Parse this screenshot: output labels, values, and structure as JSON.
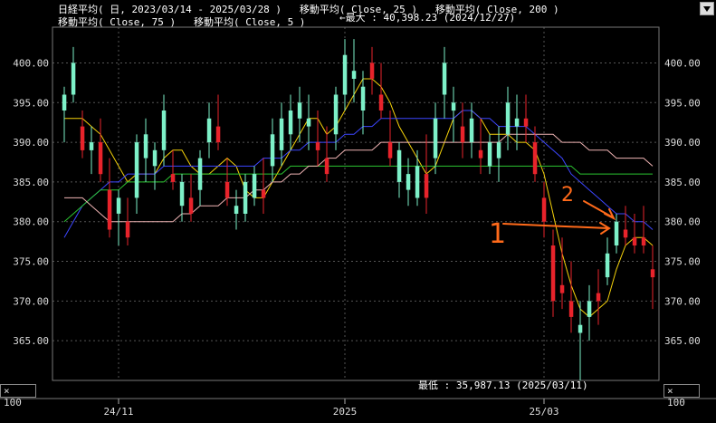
{
  "legend": {
    "line1": "日経平均( 日, 2023/03/14 - 2025/03/28 )   移動平均( Close, 25 )   移動平均( Close, 200 )",
    "line2": "移動平均( Close, 75 )   移動平均( Close, 5 )"
  },
  "annotations": {
    "max": "←最大 : 40,398.23 (2024/12/27)",
    "min": "最低 : 35,987.13 (2025/03/11)",
    "mark1": "1",
    "mark2": "2"
  },
  "scale_label": "× 100",
  "colors": {
    "up": "#7df0c8",
    "down": "#e8232b",
    "ma5": "#f5d20a",
    "ma25": "#3c46ff",
    "ma75": "#2bc431",
    "ma200": "#f0b4b4",
    "grid": "#555555",
    "annotation": "#ff6a1a"
  },
  "chart_data": {
    "type": "candlestick",
    "y_unit": "× 100 yen",
    "ylim": [
      360,
      404
    ],
    "y_ticks": [
      "365.00",
      "370.00",
      "375.00",
      "380.00",
      "385.00",
      "390.00",
      "395.00",
      "400.00"
    ],
    "x_labels": [
      "24/11",
      "2025",
      "25/03"
    ],
    "x_label_index": [
      6,
      31,
      53
    ],
    "grid": true,
    "max_label": "40,398.23 (2024/12/27)",
    "min_label": "35,987.13 (2025/03/11)",
    "ohlc": [
      [
        394,
        397,
        390,
        396
      ],
      [
        396,
        402,
        395,
        400
      ],
      [
        392,
        394,
        388,
        389
      ],
      [
        389,
        392,
        386,
        390
      ],
      [
        390,
        393,
        385,
        386
      ],
      [
        384,
        388,
        378,
        379
      ],
      [
        381,
        384,
        377,
        383
      ],
      [
        380,
        383,
        377,
        378
      ],
      [
        383,
        391,
        381,
        390
      ],
      [
        388,
        393,
        385,
        391
      ],
      [
        387,
        390,
        384,
        389
      ],
      [
        389,
        396,
        387,
        394
      ],
      [
        386,
        389,
        384,
        385
      ],
      [
        382,
        386,
        380,
        385
      ],
      [
        383,
        386,
        380,
        381
      ],
      [
        384,
        389,
        382,
        388
      ],
      [
        390,
        395,
        388,
        393
      ],
      [
        392,
        396,
        389,
        390
      ],
      [
        385,
        388,
        382,
        383
      ],
      [
        381,
        384,
        379,
        382
      ],
      [
        381,
        386,
        380,
        385
      ],
      [
        383,
        387,
        382,
        386
      ],
      [
        384,
        388,
        381,
        383
      ],
      [
        387,
        393,
        385,
        391
      ],
      [
        389,
        395,
        387,
        393
      ],
      [
        391,
        396,
        389,
        394
      ],
      [
        393,
        397,
        390,
        395
      ],
      [
        392,
        396,
        389,
        393
      ],
      [
        390,
        394,
        387,
        389
      ],
      [
        388,
        392,
        385,
        386
      ],
      [
        391,
        397,
        389,
        396
      ],
      [
        396,
        403,
        394,
        401
      ],
      [
        398,
        403,
        395,
        399
      ],
      [
        394,
        399,
        391,
        397
      ],
      [
        400,
        402,
        396,
        398
      ],
      [
        396,
        400,
        393,
        394
      ],
      [
        390,
        394,
        387,
        388
      ],
      [
        385,
        390,
        383,
        389
      ],
      [
        384,
        388,
        382,
        386
      ],
      [
        383,
        389,
        382,
        387
      ],
      [
        386,
        391,
        381,
        383
      ],
      [
        388,
        395,
        386,
        393
      ],
      [
        396,
        402,
        393,
        400
      ],
      [
        394,
        397,
        390,
        395
      ],
      [
        392,
        395,
        388,
        390
      ],
      [
        390,
        395,
        388,
        393
      ],
      [
        389,
        393,
        386,
        388
      ],
      [
        387,
        391,
        386,
        390
      ],
      [
        388,
        392,
        385,
        390
      ],
      [
        391,
        397,
        389,
        395
      ],
      [
        392,
        396,
        389,
        393
      ],
      [
        393,
        396,
        390,
        392
      ],
      [
        390,
        392,
        385,
        386
      ],
      [
        383,
        385,
        378,
        380
      ],
      [
        377,
        379,
        368,
        370
      ],
      [
        372,
        378,
        369,
        371
      ],
      [
        370,
        375,
        366,
        368
      ],
      [
        366,
        370,
        360,
        367
      ],
      [
        368,
        372,
        365,
        370
      ],
      [
        371,
        374,
        367,
        370
      ],
      [
        373,
        378,
        372,
        376
      ],
      [
        377,
        381,
        376,
        380
      ],
      [
        379,
        382,
        377,
        378
      ],
      [
        378,
        381,
        376,
        377
      ],
      [
        378,
        382,
        376,
        377
      ],
      [
        374,
        377,
        369,
        373
      ]
    ],
    "series": [
      {
        "name": "移動平均( Close, 5 )",
        "values": [
          393,
          393,
          393,
          392,
          391,
          389,
          387,
          385,
          386,
          386,
          386,
          388,
          389,
          389,
          387,
          386,
          386,
          387,
          388,
          387,
          384,
          383,
          383,
          385,
          387,
          389,
          391,
          393,
          393,
          391,
          392,
          394,
          396,
          398,
          398,
          397,
          395,
          392,
          390,
          388,
          386,
          387,
          390,
          393,
          394,
          394,
          393,
          391,
          391,
          391,
          390,
          390,
          389,
          386,
          381,
          376,
          372,
          369,
          368,
          369,
          370,
          374,
          377,
          378,
          378,
          377
        ]
      },
      {
        "name": "移動平均( Close, 25 )",
        "values": [
          378,
          380,
          382,
          383,
          384,
          385,
          385,
          386,
          386,
          386,
          386,
          387,
          387,
          387,
          387,
          387,
          387,
          387,
          387,
          387,
          387,
          387,
          388,
          388,
          388,
          389,
          389,
          390,
          390,
          390,
          390,
          391,
          391,
          392,
          392,
          393,
          393,
          393,
          393,
          393,
          393,
          393,
          393,
          393,
          394,
          394,
          393,
          393,
          392,
          392,
          392,
          392,
          391,
          390,
          389,
          388,
          386,
          385,
          384,
          383,
          382,
          381,
          381,
          380,
          380,
          379
        ]
      },
      {
        "name": "移動平均( Close, 75 )",
        "values": [
          380,
          381,
          382,
          383,
          384,
          384,
          384,
          385,
          385,
          385,
          385,
          385,
          386,
          386,
          386,
          386,
          386,
          386,
          386,
          386,
          386,
          386,
          386,
          386,
          386,
          387,
          387,
          387,
          387,
          387,
          387,
          387,
          387,
          387,
          387,
          387,
          387,
          387,
          387,
          387,
          387,
          387,
          387,
          387,
          387,
          387,
          387,
          387,
          387,
          387,
          387,
          387,
          387,
          387,
          387,
          387,
          387,
          386,
          386,
          386,
          386,
          386,
          386,
          386,
          386,
          386
        ]
      },
      {
        "name": "移動平均( Close, 200 )",
        "values": [
          383,
          383,
          383,
          382,
          381,
          380,
          380,
          380,
          380,
          380,
          380,
          380,
          380,
          381,
          381,
          382,
          382,
          382,
          383,
          383,
          383,
          384,
          384,
          385,
          385,
          386,
          386,
          387,
          387,
          388,
          388,
          389,
          389,
          389,
          389,
          390,
          390,
          390,
          390,
          390,
          390,
          390,
          390,
          390,
          390,
          390,
          390,
          390,
          390,
          391,
          391,
          391,
          391,
          391,
          391,
          390,
          390,
          390,
          389,
          389,
          389,
          388,
          388,
          388,
          388,
          387
        ]
      }
    ]
  }
}
